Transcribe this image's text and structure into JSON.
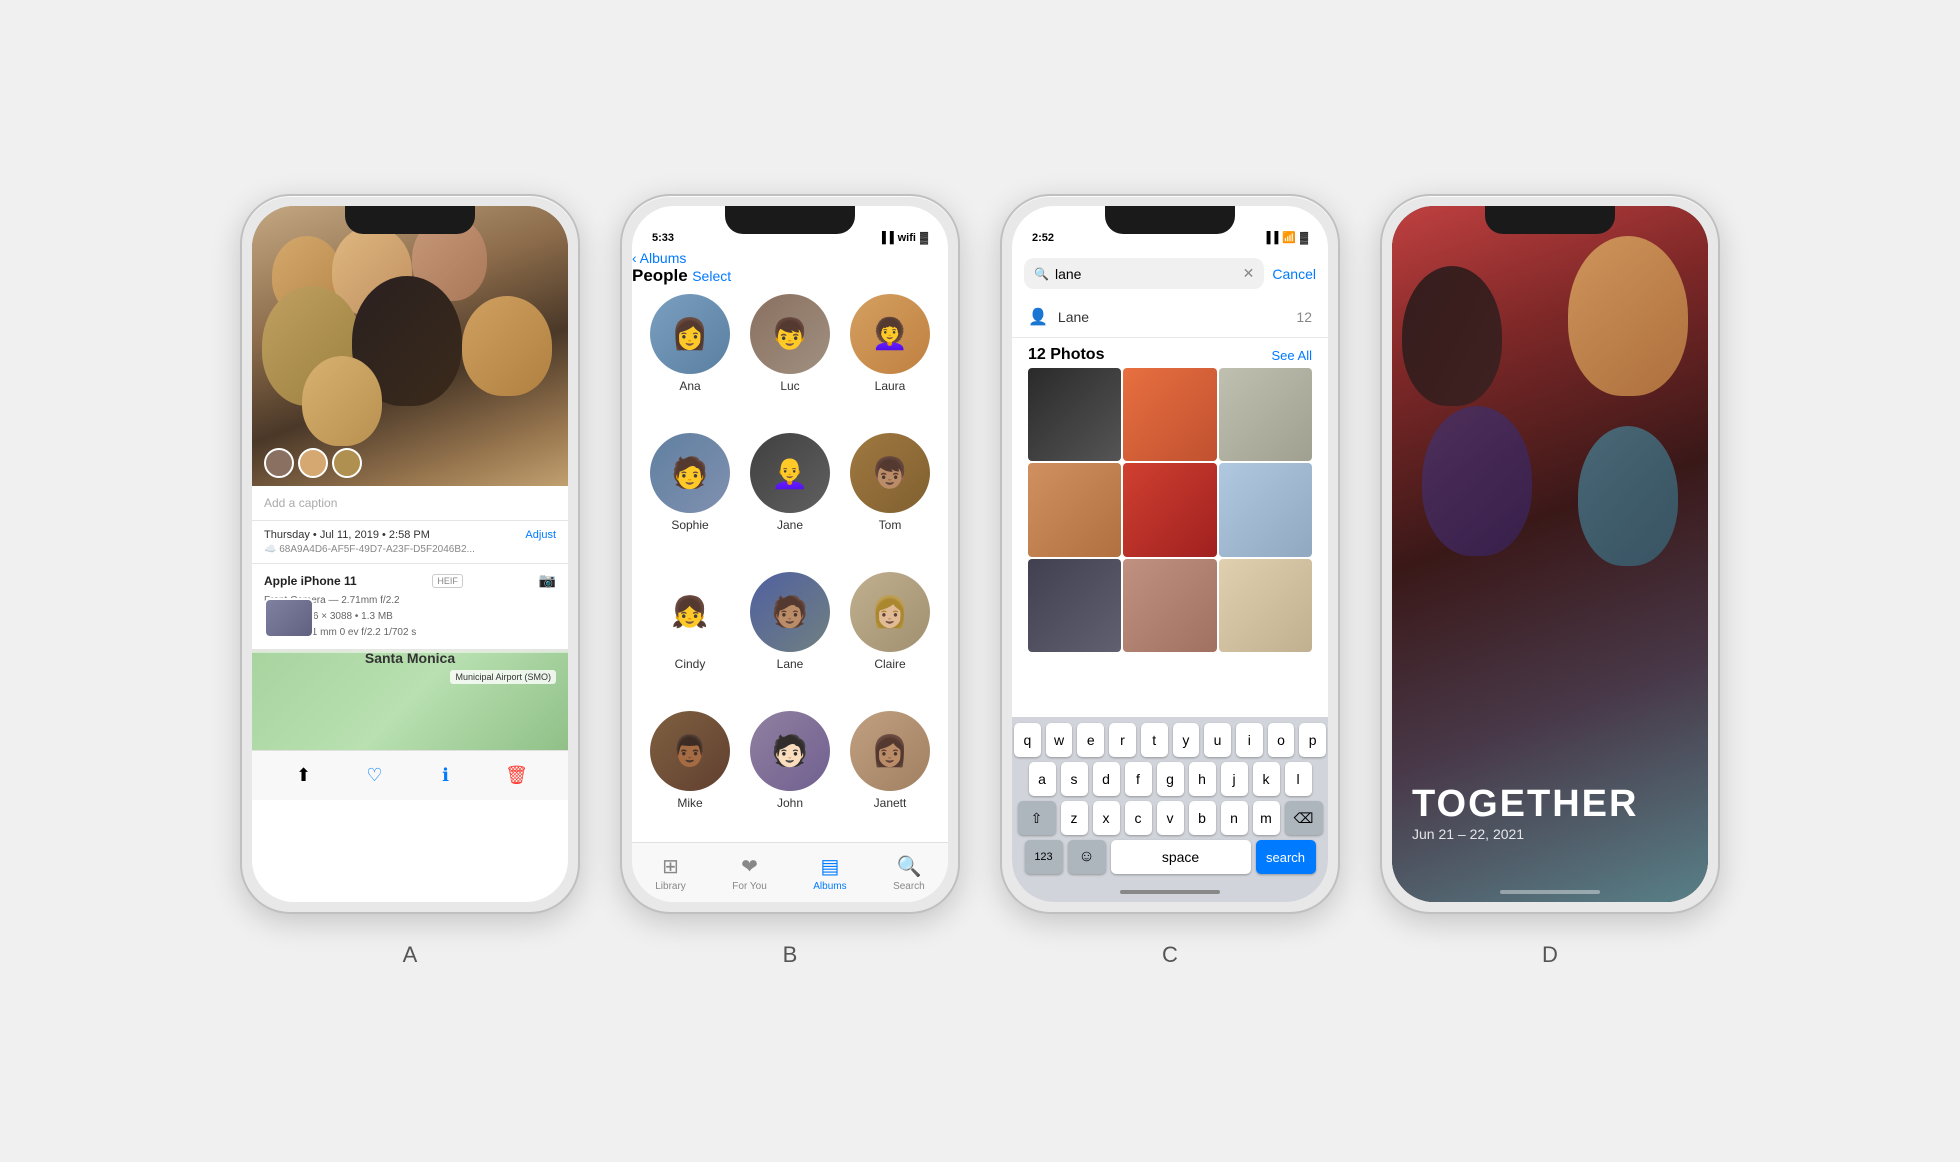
{
  "background_color": "#f0f0f0",
  "phones": {
    "a": {
      "label": "A",
      "status_time": "",
      "caption_placeholder": "Add a caption",
      "date_info": "Thursday • Jul 11, 2019 • 2:58 PM",
      "adjust_label": "Adjust",
      "cloud_id": "68A9A4D6-AF5F-49D7-A23F-D5F2046B2...",
      "device_name": "Apple iPhone 11",
      "badge_heif": "HEIF",
      "camera_info": "Front Camera — 2.71mm f/2.2",
      "photo_meta": "7 MP • 2316 × 3088 • 1.3 MB",
      "exif_row": "ISO 25    2.71 mm    0 ev    f/2.2    1/702 s",
      "map_location": "Santa Monica",
      "airport_label": "Municipal Airport (SMO)"
    },
    "b": {
      "label": "B",
      "status_time": "5:33",
      "nav_back": "Albums",
      "nav_title": "People",
      "nav_action": "Select",
      "people": [
        {
          "name": "Ana"
        },
        {
          "name": "Luc"
        },
        {
          "name": "Laura"
        },
        {
          "name": "Sophie"
        },
        {
          "name": "Jane"
        },
        {
          "name": "Tom"
        },
        {
          "name": "Cindy"
        },
        {
          "name": "Lane"
        },
        {
          "name": "Claire"
        },
        {
          "name": "Mike"
        },
        {
          "name": "John"
        },
        {
          "name": "Janett"
        }
      ],
      "tabs": [
        {
          "label": "Library",
          "active": false
        },
        {
          "label": "For You",
          "active": false
        },
        {
          "label": "Albums",
          "active": true
        },
        {
          "label": "Search",
          "active": false
        }
      ]
    },
    "c": {
      "label": "C",
      "status_time": "2:52",
      "search_query": "lane",
      "cancel_label": "Cancel",
      "suggestion_name": "Lane",
      "suggestion_count": "12",
      "photos_title": "12 Photos",
      "see_all": "See All",
      "keyboard": {
        "row1": [
          "q",
          "w",
          "e",
          "r",
          "t",
          "y",
          "u",
          "i",
          "o",
          "p"
        ],
        "row2": [
          "a",
          "s",
          "d",
          "f",
          "g",
          "h",
          "j",
          "k",
          "l"
        ],
        "row3": [
          "z",
          "x",
          "c",
          "v",
          "b",
          "n",
          "m"
        ],
        "space_label": "space",
        "search_label": "search"
      }
    },
    "d": {
      "label": "D",
      "together_title": "TOGETHER",
      "together_date": "Jun 21 – 22, 2021"
    }
  }
}
